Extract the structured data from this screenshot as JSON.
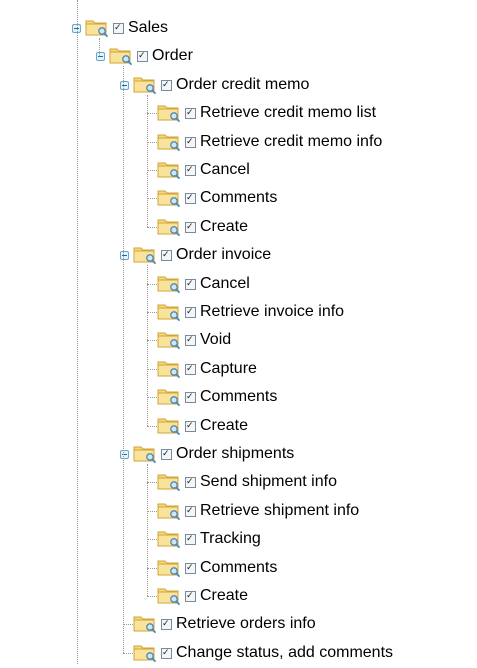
{
  "tree": [
    {
      "label": "Sales",
      "level": 0,
      "expanded": true,
      "checked": true,
      "children": [
        {
          "label": "Order",
          "level": 1,
          "expanded": true,
          "checked": true,
          "children": [
            {
              "label": "Order credit memo",
              "level": 2,
              "expanded": true,
              "checked": true,
              "children": [
                {
                  "label": "Retrieve credit memo list",
                  "checked": true
                },
                {
                  "label": "Retrieve credit memo info",
                  "checked": true
                },
                {
                  "label": "Cancel",
                  "checked": true
                },
                {
                  "label": "Comments",
                  "checked": true
                },
                {
                  "label": "Create",
                  "checked": true
                }
              ]
            },
            {
              "label": "Order invoice",
              "level": 2,
              "expanded": true,
              "checked": true,
              "children": [
                {
                  "label": "Cancel",
                  "checked": true
                },
                {
                  "label": "Retrieve invoice info",
                  "checked": true
                },
                {
                  "label": "Void",
                  "checked": true
                },
                {
                  "label": "Capture",
                  "checked": true
                },
                {
                  "label": "Comments",
                  "checked": true
                },
                {
                  "label": "Create",
                  "checked": true
                }
              ]
            },
            {
              "label": "Order shipments",
              "level": 2,
              "expanded": true,
              "checked": true,
              "children": [
                {
                  "label": "Send shipment info",
                  "checked": true
                },
                {
                  "label": "Retrieve shipment info",
                  "checked": true
                },
                {
                  "label": "Tracking",
                  "checked": true
                },
                {
                  "label": "Comments",
                  "checked": true
                },
                {
                  "label": "Create",
                  "checked": true
                }
              ]
            },
            {
              "label": "Retrieve orders info",
              "level": 2,
              "checked": true
            },
            {
              "label": "Change status, add comments",
              "level": 2,
              "checked": true
            }
          ]
        }
      ]
    }
  ],
  "icons": {
    "toggle": "collapse-minus-icon",
    "folder": "folder-with-magnifier-icon",
    "checkbox": "checkbox-checked-icon"
  },
  "colors": {
    "folder": "#f2c75c",
    "toggle_border": "#67a9c9",
    "connector": "#9a9a9a"
  }
}
